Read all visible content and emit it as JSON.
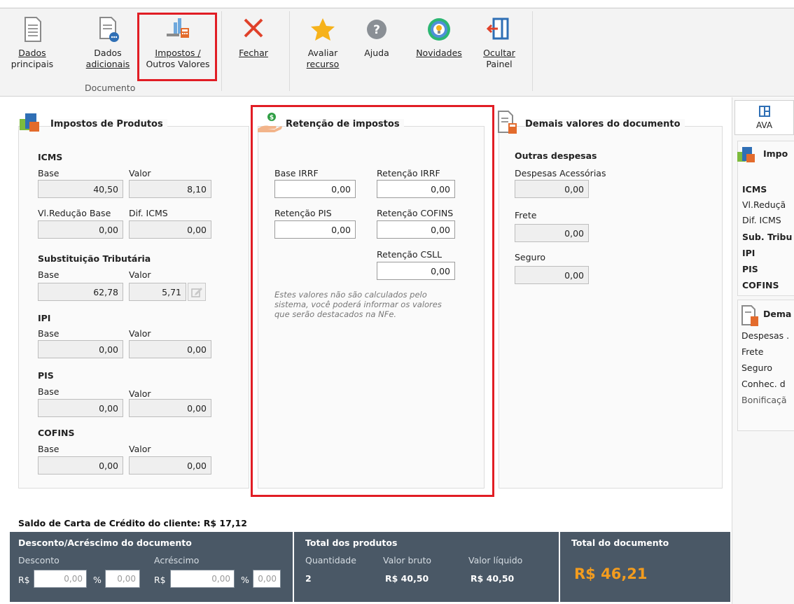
{
  "ribbon": {
    "buttons": [
      {
        "line1": "Dados",
        "line2": "principais",
        "icon": "document-icon"
      },
      {
        "line1": "Dados",
        "line2": "adicionais",
        "icon": "document-more-icon"
      },
      {
        "line1": "Impostos /",
        "line2": "Outros Valores",
        "icon": "taxes-icon"
      },
      {
        "line1": "Fechar",
        "line2": "",
        "icon": "close-icon"
      },
      {
        "line1": "Avaliar",
        "line2": "recurso",
        "icon": "star-icon"
      },
      {
        "line1": "Ajuda",
        "line2": "",
        "icon": "help-icon"
      },
      {
        "line1": "Novidades",
        "line2": "",
        "icon": "lightbulb-icon"
      },
      {
        "line1": "Ocultar",
        "line2": "Painel",
        "icon": "hide-panel-icon"
      }
    ],
    "group_caption": "Documento"
  },
  "impostos_produtos": {
    "title": "Impostos de Produtos",
    "icms_title": "ICMS",
    "base_label": "Base",
    "valor_label": "Valor",
    "icms_base": "40,50",
    "icms_valor": "8,10",
    "vl_reducao_label": "Vl.Redução Base",
    "dif_icms_label": "Dif. ICMS",
    "vl_reducao": "0,00",
    "dif_icms": "0,00",
    "st_title": "Substituição Tributária",
    "st_base": "62,78",
    "st_valor": "5,71",
    "ipi_title": "IPI",
    "ipi_base": "0,00",
    "ipi_valor": "0,00",
    "pis_title": "PIS",
    "pis_base": "0,00",
    "pis_valor": "0,00",
    "cofins_title": "COFINS",
    "cofins_base": "0,00",
    "cofins_valor": "0,00"
  },
  "retencao": {
    "title": "Retenção de impostos",
    "base_irrf_label": "Base IRRF",
    "retencao_irrf_label": "Retenção IRRF",
    "retencao_pis_label": "Retenção PIS",
    "retencao_cofins_label": "Retenção COFINS",
    "retencao_csll_label": "Retenção CSLL",
    "base_irrf": "0,00",
    "retencao_irrf": "0,00",
    "retencao_pis": "0,00",
    "retencao_cofins": "0,00",
    "retencao_csll": "0,00",
    "note_line1": "Estes valores não são calculados pelo",
    "note_line2": "sistema, você poderá informar os valores",
    "note_line3": "que serão destacados na NFe."
  },
  "demais": {
    "title": "Demais valores do documento",
    "outras_title": "Outras despesas",
    "despesas_label": "Despesas Acessórias",
    "despesas": "0,00",
    "frete_label": "Frete",
    "frete": "0,00",
    "seguro_label": "Seguro",
    "seguro": "0,00"
  },
  "right_pane": {
    "ava_label": "AVA",
    "impostos_title": "Impo",
    "items": [
      "ICMS",
      "Vl.Reduçã",
      "Dif. ICMS",
      "Sub. Tribu",
      "IPI",
      "PIS",
      "COFINS"
    ],
    "demais_title": "Dema",
    "demais_items": [
      "Despesas .",
      "Frete",
      "Seguro",
      "Conhec. d",
      "Bonificaçã"
    ]
  },
  "saldo": "Saldo de Carta de Crédito do cliente: R$ 17,12",
  "footer": {
    "desc_title": "Desconto/Acréscimo do documento",
    "desconto_label": "Desconto",
    "acrescimo_label": "Acréscimo",
    "currency": "R$",
    "percent": "%",
    "desconto_valor": "0,00",
    "desconto_pct": "0,00",
    "acrescimo_valor": "0,00",
    "acrescimo_pct": "0,00",
    "total_produtos_title": "Total dos produtos",
    "quantidade_label": "Quantidade",
    "valor_bruto_label": "Valor bruto",
    "valor_liquido_label": "Valor líquido",
    "quantidade": "2",
    "valor_bruto": "R$ 40,50",
    "valor_liquido": "R$ 40,50",
    "total_documento_title": "Total do documento",
    "total_documento": "R$ 46,21"
  },
  "colors": {
    "highlight": "#e11d24",
    "footer_bg": "#4a5866",
    "total_orange": "#f39c1e"
  }
}
